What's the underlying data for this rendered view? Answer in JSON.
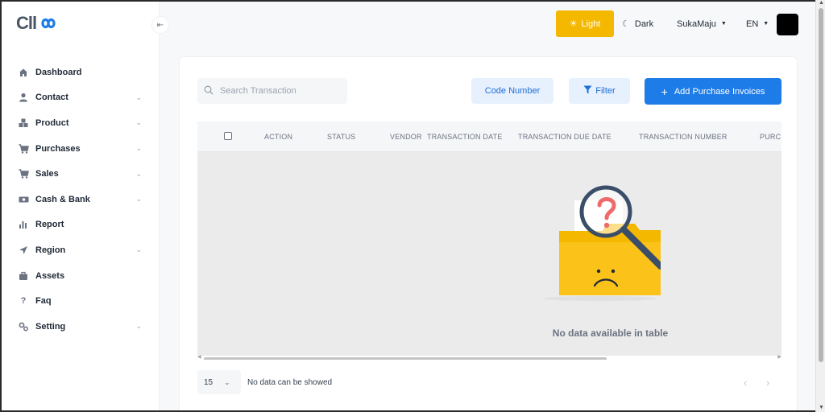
{
  "brand": {
    "logo_text": "Cll"
  },
  "sidebar": {
    "items": [
      {
        "label": "Dashboard",
        "icon": "home-icon",
        "chevron": false
      },
      {
        "label": "Contact",
        "icon": "user-icon",
        "chevron": true
      },
      {
        "label": "Product",
        "icon": "cubes-icon",
        "chevron": true
      },
      {
        "label": "Purchases",
        "icon": "cart-icon",
        "chevron": true
      },
      {
        "label": "Sales",
        "icon": "cart-icon",
        "chevron": true
      },
      {
        "label": "Cash & Bank",
        "icon": "money-icon",
        "chevron": true
      },
      {
        "label": "Report",
        "icon": "bar-chart-icon",
        "chevron": false
      },
      {
        "label": "Region",
        "icon": "navigation-icon",
        "chevron": true
      },
      {
        "label": "Assets",
        "icon": "briefcase-icon",
        "chevron": false
      },
      {
        "label": "Faq",
        "icon": "question-icon",
        "chevron": false
      },
      {
        "label": "Setting",
        "icon": "gears-icon",
        "chevron": true
      }
    ]
  },
  "topbar": {
    "light_label": "Light",
    "dark_label": "Dark",
    "user_name": "SukaMaju",
    "language": "EN"
  },
  "toolbar": {
    "search_placeholder": "Search Transaction",
    "code_number_label": "Code Number",
    "filter_label": "Filter",
    "add_label": "Add Purchase Invoices"
  },
  "table": {
    "columns": [
      "ACTION",
      "STATUS",
      "VENDOR",
      "TRANSACTION DATE",
      "TRANSACTION DUE DATE",
      "TRANSACTION NUMBER",
      "PURCI"
    ],
    "empty_message": "No data available in table"
  },
  "footer": {
    "page_size": "15",
    "status_text": "No data can be showed"
  },
  "colors": {
    "light_button": "#f5b800",
    "primary": "#1e7ce8",
    "soft_primary_bg": "#e7f0fd"
  }
}
